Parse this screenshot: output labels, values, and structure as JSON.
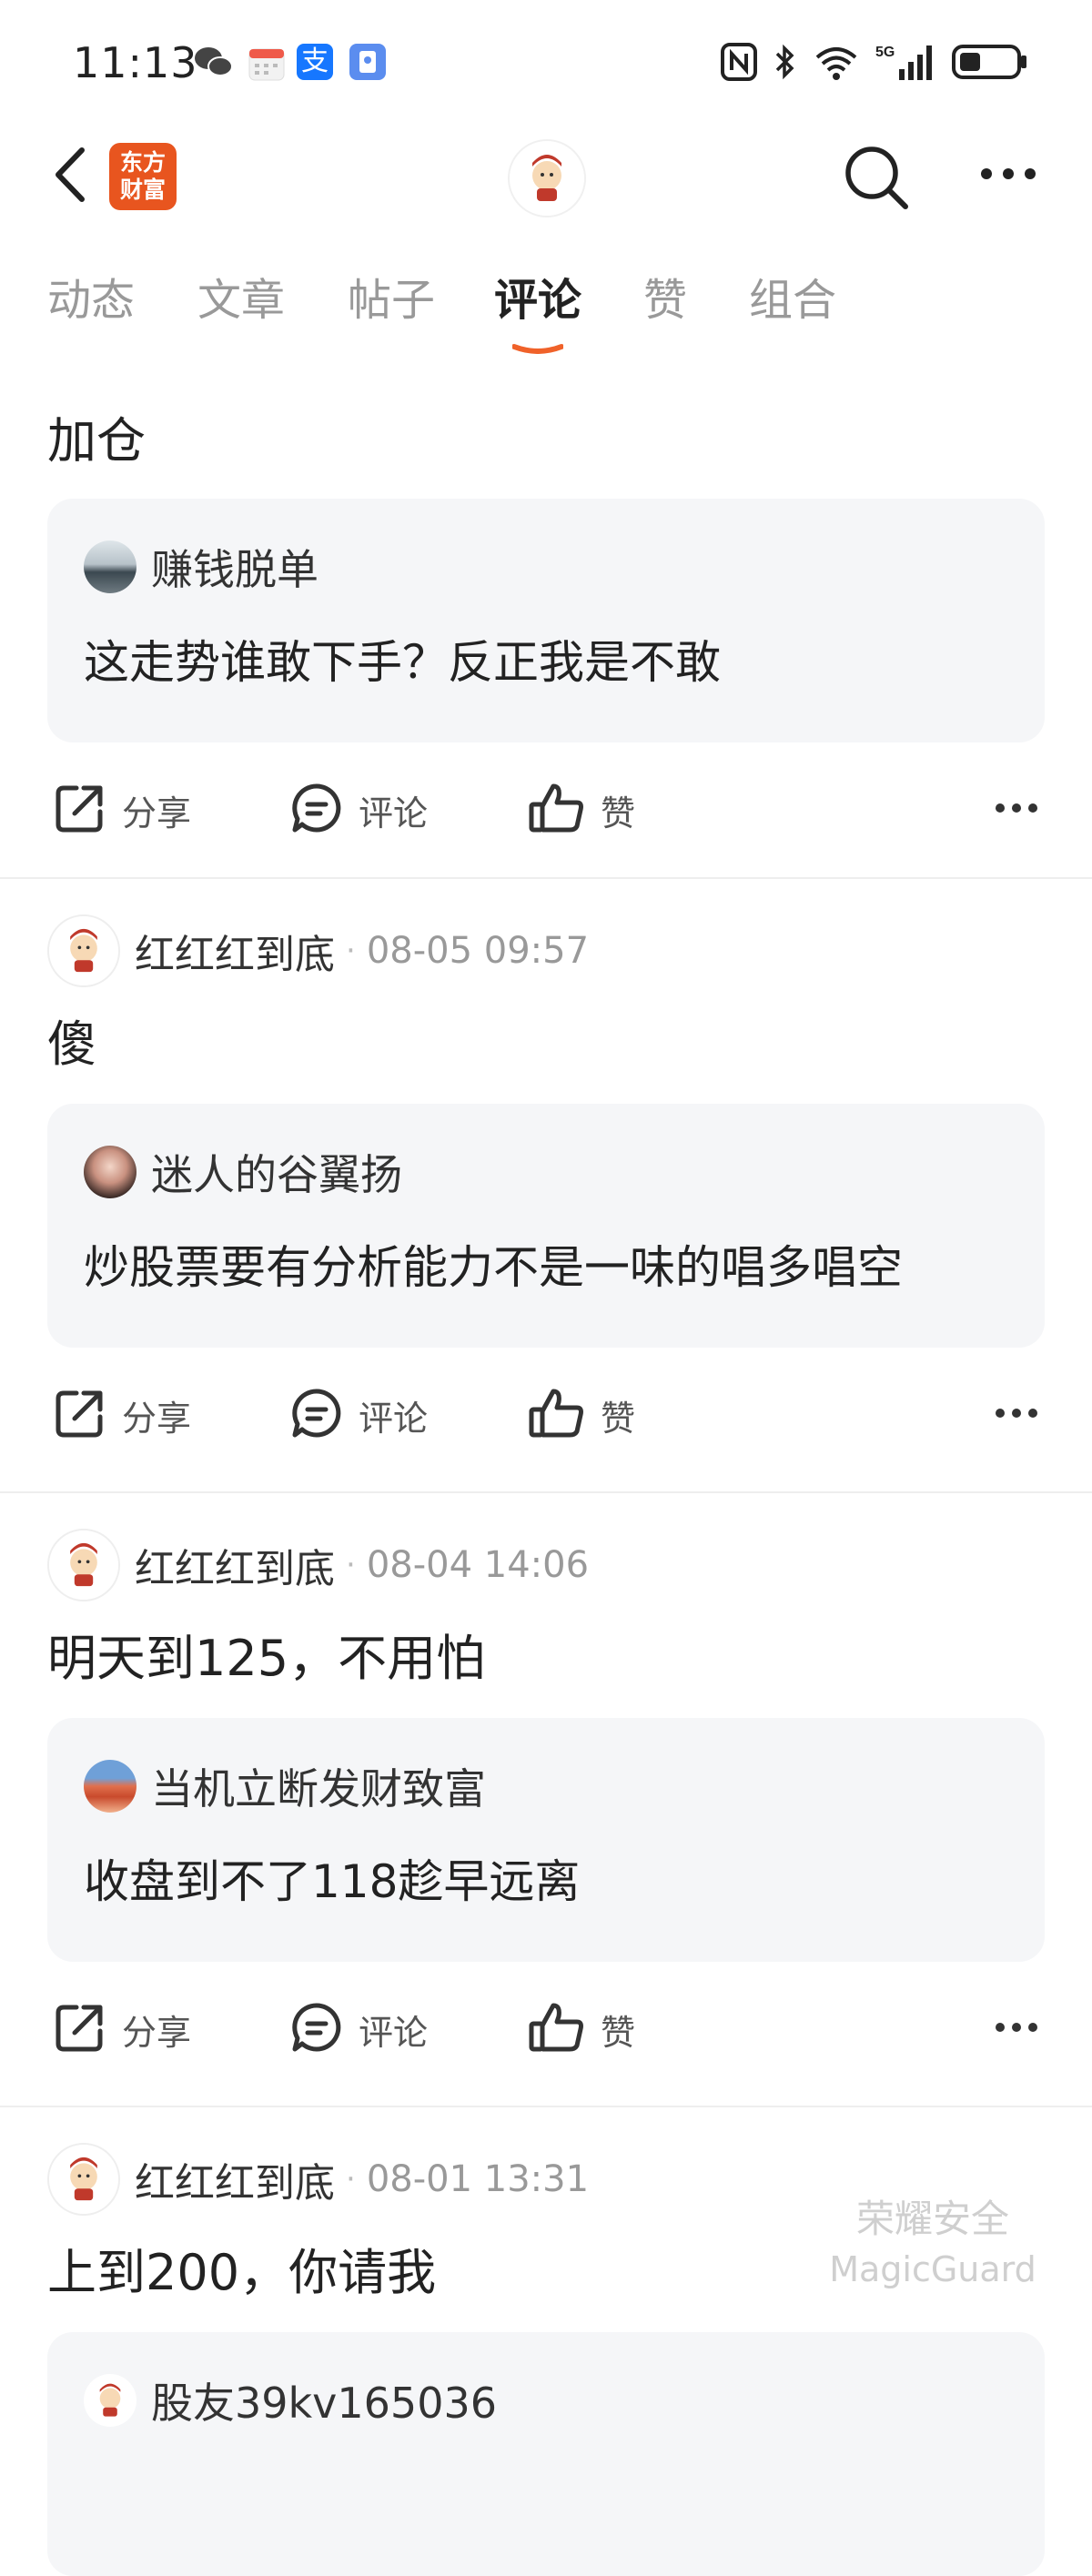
{
  "status": {
    "time": "11:13"
  },
  "header": {
    "logo_line1": "东方",
    "logo_line2": "财富"
  },
  "tabs": [
    "动态",
    "文章",
    "帖子",
    "评论",
    "赞",
    "组合"
  ],
  "active_tab": "评论",
  "actions": {
    "share": "分享",
    "comment": "评论",
    "like": "赞"
  },
  "posts": [
    {
      "author": "",
      "time": "",
      "text": "加仓",
      "quote": {
        "author": "赚钱脱单",
        "text": "这走势谁敢下手？反正我是不敢"
      }
    },
    {
      "author": "红红红到底",
      "time": "08-05 09:57",
      "text": "傻",
      "quote": {
        "author": "迷人的谷翼扬",
        "text": "炒股票要有分析能力不是一味的唱多唱空"
      }
    },
    {
      "author": "红红红到底",
      "time": "08-04 14:06",
      "text": "明天到125，不用怕",
      "quote": {
        "author": "当机立断发财致富",
        "text": "收盘到不了118趁早远离"
      }
    },
    {
      "author": "红红红到底",
      "time": "08-01 13:31",
      "text": "上到200，你请我",
      "quote": {
        "author": "股友39kv165036",
        "text": ""
      }
    }
  ],
  "watermark": {
    "line1": "荣耀安全",
    "line2": "MagicGuard"
  },
  "colors": {
    "accent": "#f0622a",
    "logo_bg": "#e8551f",
    "quote_bg": "#f5f6f8"
  }
}
